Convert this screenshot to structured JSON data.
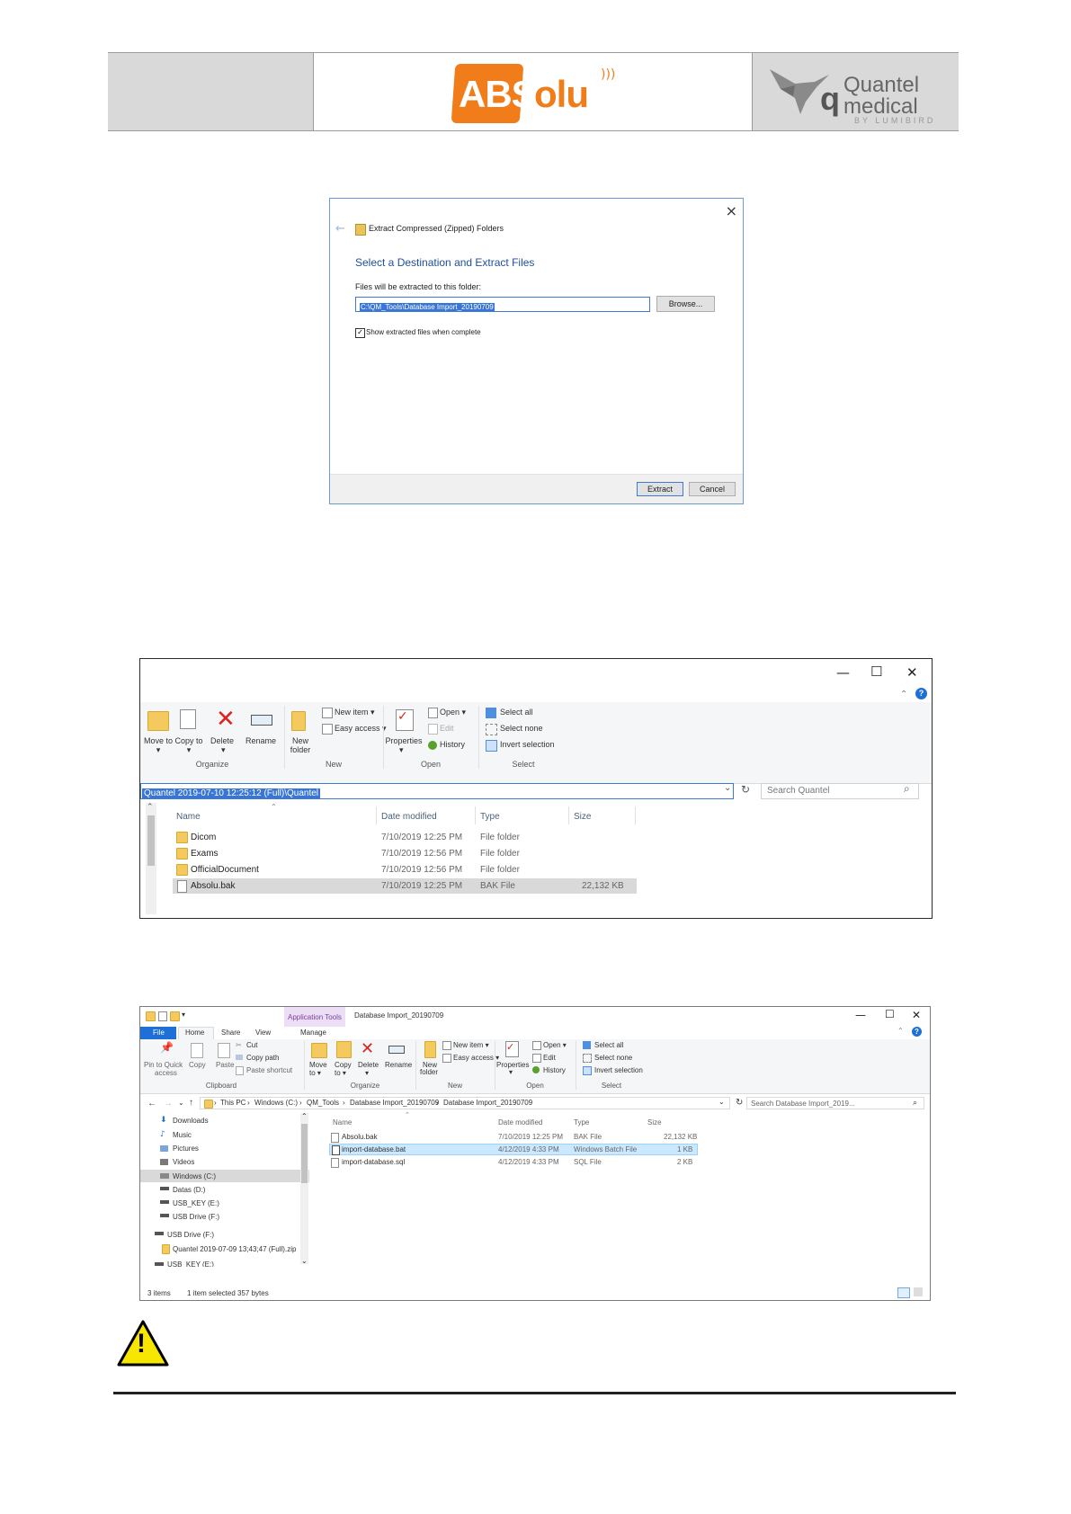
{
  "header": {
    "brand_abs": "ABS",
    "brand_olu": "olu",
    "partner_mark": "q",
    "partner_name_1": "Quantel",
    "partner_name_2": "medical",
    "partner_sub": "BY LUMIBIRD"
  },
  "dialog": {
    "close": "×",
    "back": "←",
    "title": "Extract Compressed (Zipped) Folders",
    "heading": "Select a Destination and Extract Files",
    "label": "Files will be extracted to this folder:",
    "path": "C:\\QM_Tools\\Database Import_20190709",
    "browse": "Browse...",
    "checkbox_mark": "✓",
    "checkbox_label": "Show extracted files when complete",
    "extract": "Extract",
    "cancel": "Cancel"
  },
  "explorer1": {
    "controls": {
      "min": "—",
      "max": "☐",
      "close": "✕",
      "caret": "⌃",
      "help": "?"
    },
    "ribbon": {
      "move_to": "Move to ▾",
      "copy_to": "Copy to ▾",
      "delete": "Delete",
      "delete_arrow": "▾",
      "rename": "Rename",
      "new_folder_1": "New",
      "new_folder_2": "folder",
      "new_item": "New item ▾",
      "easy_access": "Easy access ▾",
      "properties": "Properties",
      "properties_arrow": "▾",
      "open": "Open ▾",
      "edit": "Edit",
      "history": "History",
      "select_all": "Select all",
      "select_none": "Select none",
      "invert_selection": "Invert selection",
      "groups": {
        "organize": "Organize",
        "new": "New",
        "open": "Open",
        "select": "Select"
      }
    },
    "address": "Quantel 2019-07-10 12:25:12 (Full)\\Quantel",
    "address_dropdown": "⌄",
    "refresh": "↻",
    "search_placeholder": "Search Quantel",
    "search_icon": "⌕",
    "scroll_up": "⌃",
    "columns": {
      "name": "Name",
      "date": "Date modified",
      "type": "Type",
      "size": "Size"
    },
    "rows": [
      {
        "name": "Dicom",
        "date": "7/10/2019 12:25 PM",
        "type": "File folder",
        "size": ""
      },
      {
        "name": "Exams",
        "date": "7/10/2019 12:56 PM",
        "type": "File folder",
        "size": ""
      },
      {
        "name": "OfficialDocument",
        "date": "7/10/2019 12:56 PM",
        "type": "File folder",
        "size": ""
      },
      {
        "name": "Absolu.bak",
        "date": "7/10/2019 12:25 PM",
        "type": "BAK File",
        "size": "22,132 KB"
      }
    ]
  },
  "explorer2": {
    "qat": "▾",
    "tab_context": "Application Tools",
    "window_title": "Database Import_20190709",
    "tabs": {
      "file": "File",
      "home": "Home",
      "share": "Share",
      "view": "View",
      "manage": "Manage"
    },
    "controls": {
      "min": "—",
      "max": "☐",
      "close": "✕",
      "caret": "⌃",
      "help": "?"
    },
    "ribbon": {
      "pin_1": "Pin to Quick",
      "pin_2": "access",
      "copy": "Copy",
      "paste": "Paste",
      "cut": "Cut",
      "copy_path": "Copy path",
      "paste_shortcut": "Paste shortcut",
      "move_to": "Move to ▾",
      "copy_to": "Copy to ▾",
      "delete": "Delete",
      "delete_arrow": "▾",
      "rename": "Rename",
      "new_folder_1": "New",
      "new_folder_2": "folder",
      "new_item": "New item ▾",
      "easy_access": "Easy access ▾",
      "properties": "Properties",
      "properties_arrow": "▾",
      "open": "Open ▾",
      "edit": "Edit",
      "history": "History",
      "select_all": "Select all",
      "select_none": "Select none",
      "invert_selection": "Invert selection",
      "groups": {
        "clipboard": "Clipboard",
        "organize": "Organize",
        "new": "New",
        "open": "Open",
        "select": "Select"
      }
    },
    "nav": {
      "back": "←",
      "forward": "→",
      "recent": "⌄",
      "up": "↑",
      "dropdown": "⌄",
      "refresh": "↻",
      "search_icon": "⌕"
    },
    "breadcrumb": [
      "This PC",
      "Windows (C:)",
      "QM_Tools",
      "Database Import_20190709",
      "Database Import_20190709"
    ],
    "crumb_sep": "›",
    "search_placeholder": "Search Database Import_2019...",
    "sidebar": [
      "Downloads",
      "Music",
      "Pictures",
      "Videos",
      "Windows (C:)",
      "Datas (D:)",
      "USB_KEY (E:)",
      "USB Drive (F:)",
      "USB Drive (F:)",
      "Quantel 2019-07-09 13;43;47 (Full).zip",
      "USB_KEY (E:)"
    ],
    "scroll_up": "⌃",
    "scroll_down": "⌄",
    "columns": {
      "name": "Name",
      "date": "Date modified",
      "type": "Type",
      "size": "Size"
    },
    "rows": [
      {
        "name": "Absolu.bak",
        "date": "7/10/2019 12:25 PM",
        "type": "BAK File",
        "size": "22,132 KB"
      },
      {
        "name": "import-database.bat",
        "date": "4/12/2019 4:33 PM",
        "type": "Windows Batch File",
        "size": "1 KB"
      },
      {
        "name": "import-database.sql",
        "date": "4/12/2019 4:33 PM",
        "type": "SQL File",
        "size": "2 KB"
      }
    ],
    "status_items": "3 items",
    "status_selected": "1 item selected  357 bytes"
  },
  "warning_mark": "!"
}
